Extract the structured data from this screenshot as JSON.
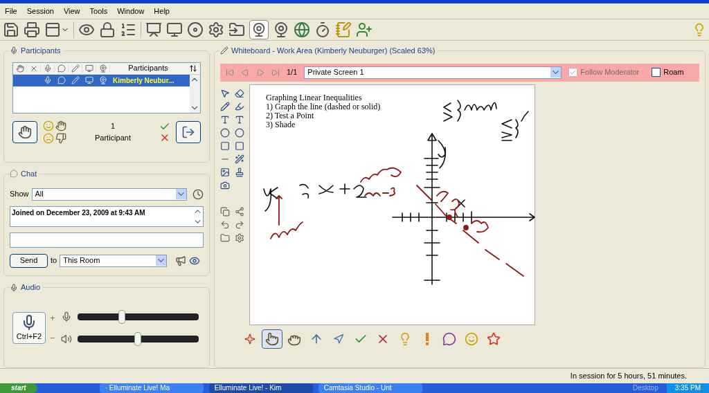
{
  "menu": [
    "File",
    "Session",
    "View",
    "Tools",
    "Window",
    "Help"
  ],
  "participants": {
    "title": "Participants",
    "column_header": "Participants",
    "rows": [
      {
        "name": "Kimberly Neubur...",
        "selected": true
      }
    ],
    "count": "1",
    "count_label": "Participant"
  },
  "chat": {
    "title": "Chat",
    "show_label": "Show",
    "filter": "All",
    "messages": [
      "Joined on December 23, 2009 at 9:43 AM"
    ],
    "send": "Send",
    "to_label": "to",
    "recipient": "This Room"
  },
  "audio": {
    "title": "Audio",
    "talk_button": "Ctrl+F2",
    "plus": "+",
    "minus": "−",
    "sliders": [
      {
        "kind": "microphone",
        "level": 0.37
      },
      {
        "kind": "speaker",
        "level": 0.5
      }
    ]
  },
  "whiteboard": {
    "title": "Whiteboard - Work Area (Kimberly Neuburger) (Scaled 63%)",
    "page": "1/1",
    "screen": "Private Screen 1",
    "follow_moderator": {
      "label": "Follow Moderator",
      "checked": true,
      "disabled": true
    },
    "roam": {
      "label": "Roam",
      "checked": false
    },
    "lines": [
      "Graphing Linear Inequalities",
      "1) Graph the line (dashed or solid)",
      "2) Test a Point",
      "3) Shade"
    ],
    "annotation_tools": [
      {
        "kind": "sparkle",
        "selected": false
      },
      {
        "kind": "hand-right",
        "selected": true
      },
      {
        "kind": "hand-left",
        "selected": false
      },
      {
        "kind": "arrow-up",
        "selected": false
      },
      {
        "kind": "arrow-slant",
        "selected": false
      },
      {
        "kind": "check",
        "selected": false
      },
      {
        "kind": "cross",
        "selected": false
      },
      {
        "kind": "bulb",
        "selected": false
      },
      {
        "kind": "exclaim",
        "selected": false
      },
      {
        "kind": "speech",
        "selected": false
      },
      {
        "kind": "smiley",
        "selected": false
      },
      {
        "kind": "star",
        "selected": false
      }
    ]
  },
  "status_bar": "In session for 5 hours, 51 minutes.",
  "taskbar": {
    "start": "start",
    "tasks": [
      {
        "label": "· Elluminate Live! Ma",
        "selected": false
      },
      {
        "label": "Elluminate Live! - Kim",
        "selected": true
      },
      {
        "label": "Camtasia Studio - Unt",
        "selected": false
      }
    ],
    "desktop": "Desktop",
    "time": "3:35 PM"
  }
}
